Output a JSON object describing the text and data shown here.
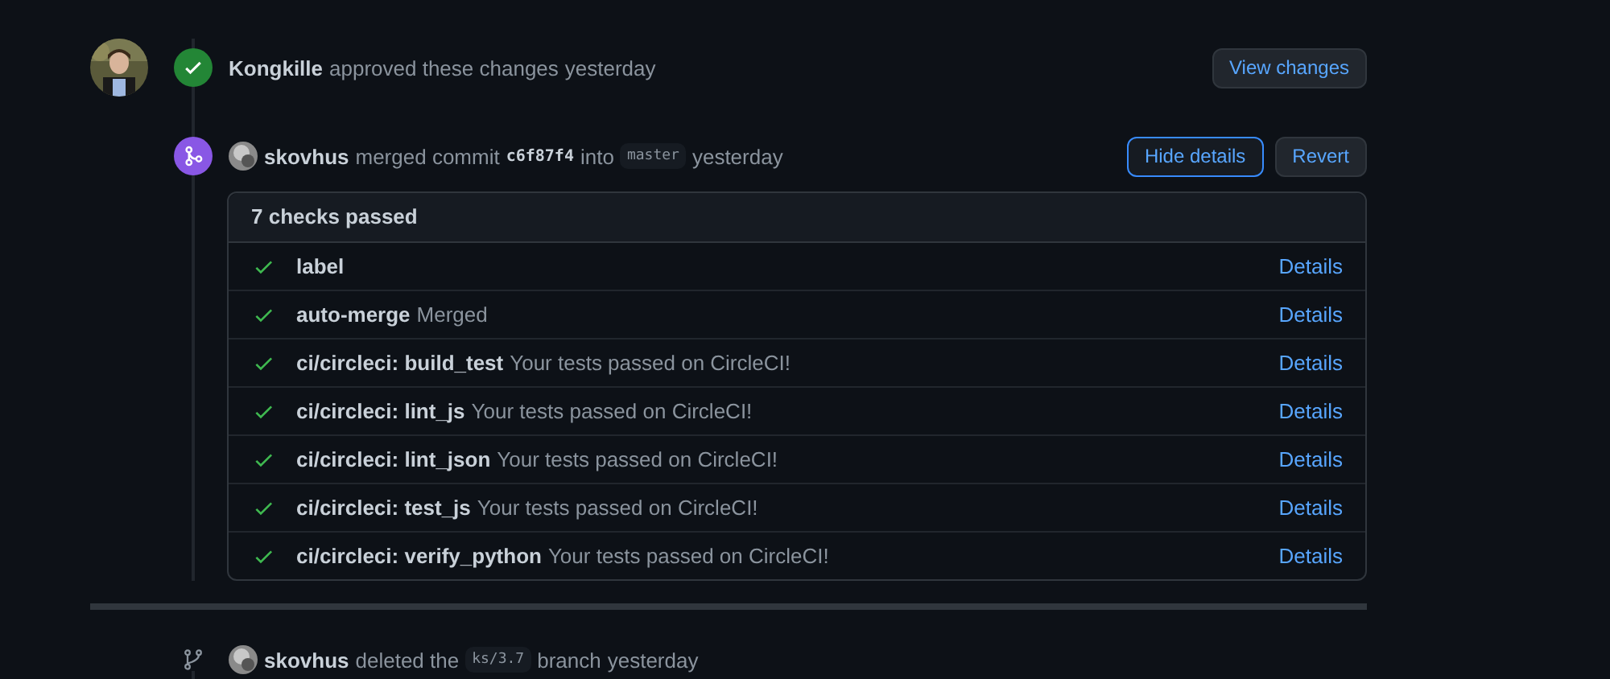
{
  "events": [
    {
      "kind": "approved",
      "has_avatar": true,
      "segments": [
        {
          "kind": "actor",
          "text": "Kongkille"
        },
        {
          "kind": "text",
          "text": "approved these changes"
        },
        {
          "kind": "time",
          "text": "yesterday"
        }
      ],
      "buttons": [
        {
          "label": "View changes",
          "focused": false
        }
      ]
    },
    {
      "kind": "merged",
      "has_avatar": false,
      "segments": [
        {
          "kind": "actor",
          "text": "skovhus"
        },
        {
          "kind": "text",
          "text": "merged commit"
        },
        {
          "kind": "code",
          "text": "c6f87f4"
        },
        {
          "kind": "text",
          "text": "into"
        },
        {
          "kind": "branch",
          "text": "master"
        },
        {
          "kind": "time",
          "text": "yesterday"
        }
      ],
      "buttons": [
        {
          "label": "Hide details",
          "focused": true
        },
        {
          "label": "Revert",
          "focused": false
        }
      ]
    }
  ],
  "checks": {
    "title": "7 checks passed",
    "items": [
      {
        "name": "label",
        "link": "Details"
      },
      {
        "name": "auto-merge",
        "description": "Merged",
        "link": "Details"
      },
      {
        "name": "ci/circleci: build_test",
        "description": "Your tests passed on CircleCI!",
        "link": "Details"
      },
      {
        "name": "ci/circleci: lint_js",
        "description": "Your tests passed on CircleCI!",
        "link": "Details"
      },
      {
        "name": "ci/circleci: lint_json",
        "description": "Your tests passed on CircleCI!",
        "link": "Details"
      },
      {
        "name": "ci/circleci: test_js",
        "description": "Your tests passed on CircleCI!",
        "link": "Details"
      },
      {
        "name": "ci/circleci: verify_python",
        "description": "Your tests passed on CircleCI!",
        "link": "Details"
      }
    ]
  },
  "deleted_event": {
    "kind": "deleted",
    "segments": [
      {
        "kind": "actor",
        "text": "skovhus"
      },
      {
        "kind": "text",
        "text": "deleted the"
      },
      {
        "kind": "branch",
        "text": "ks/3.7"
      },
      {
        "kind": "text",
        "text": "branch"
      },
      {
        "kind": "time",
        "text": "yesterday"
      }
    ]
  }
}
